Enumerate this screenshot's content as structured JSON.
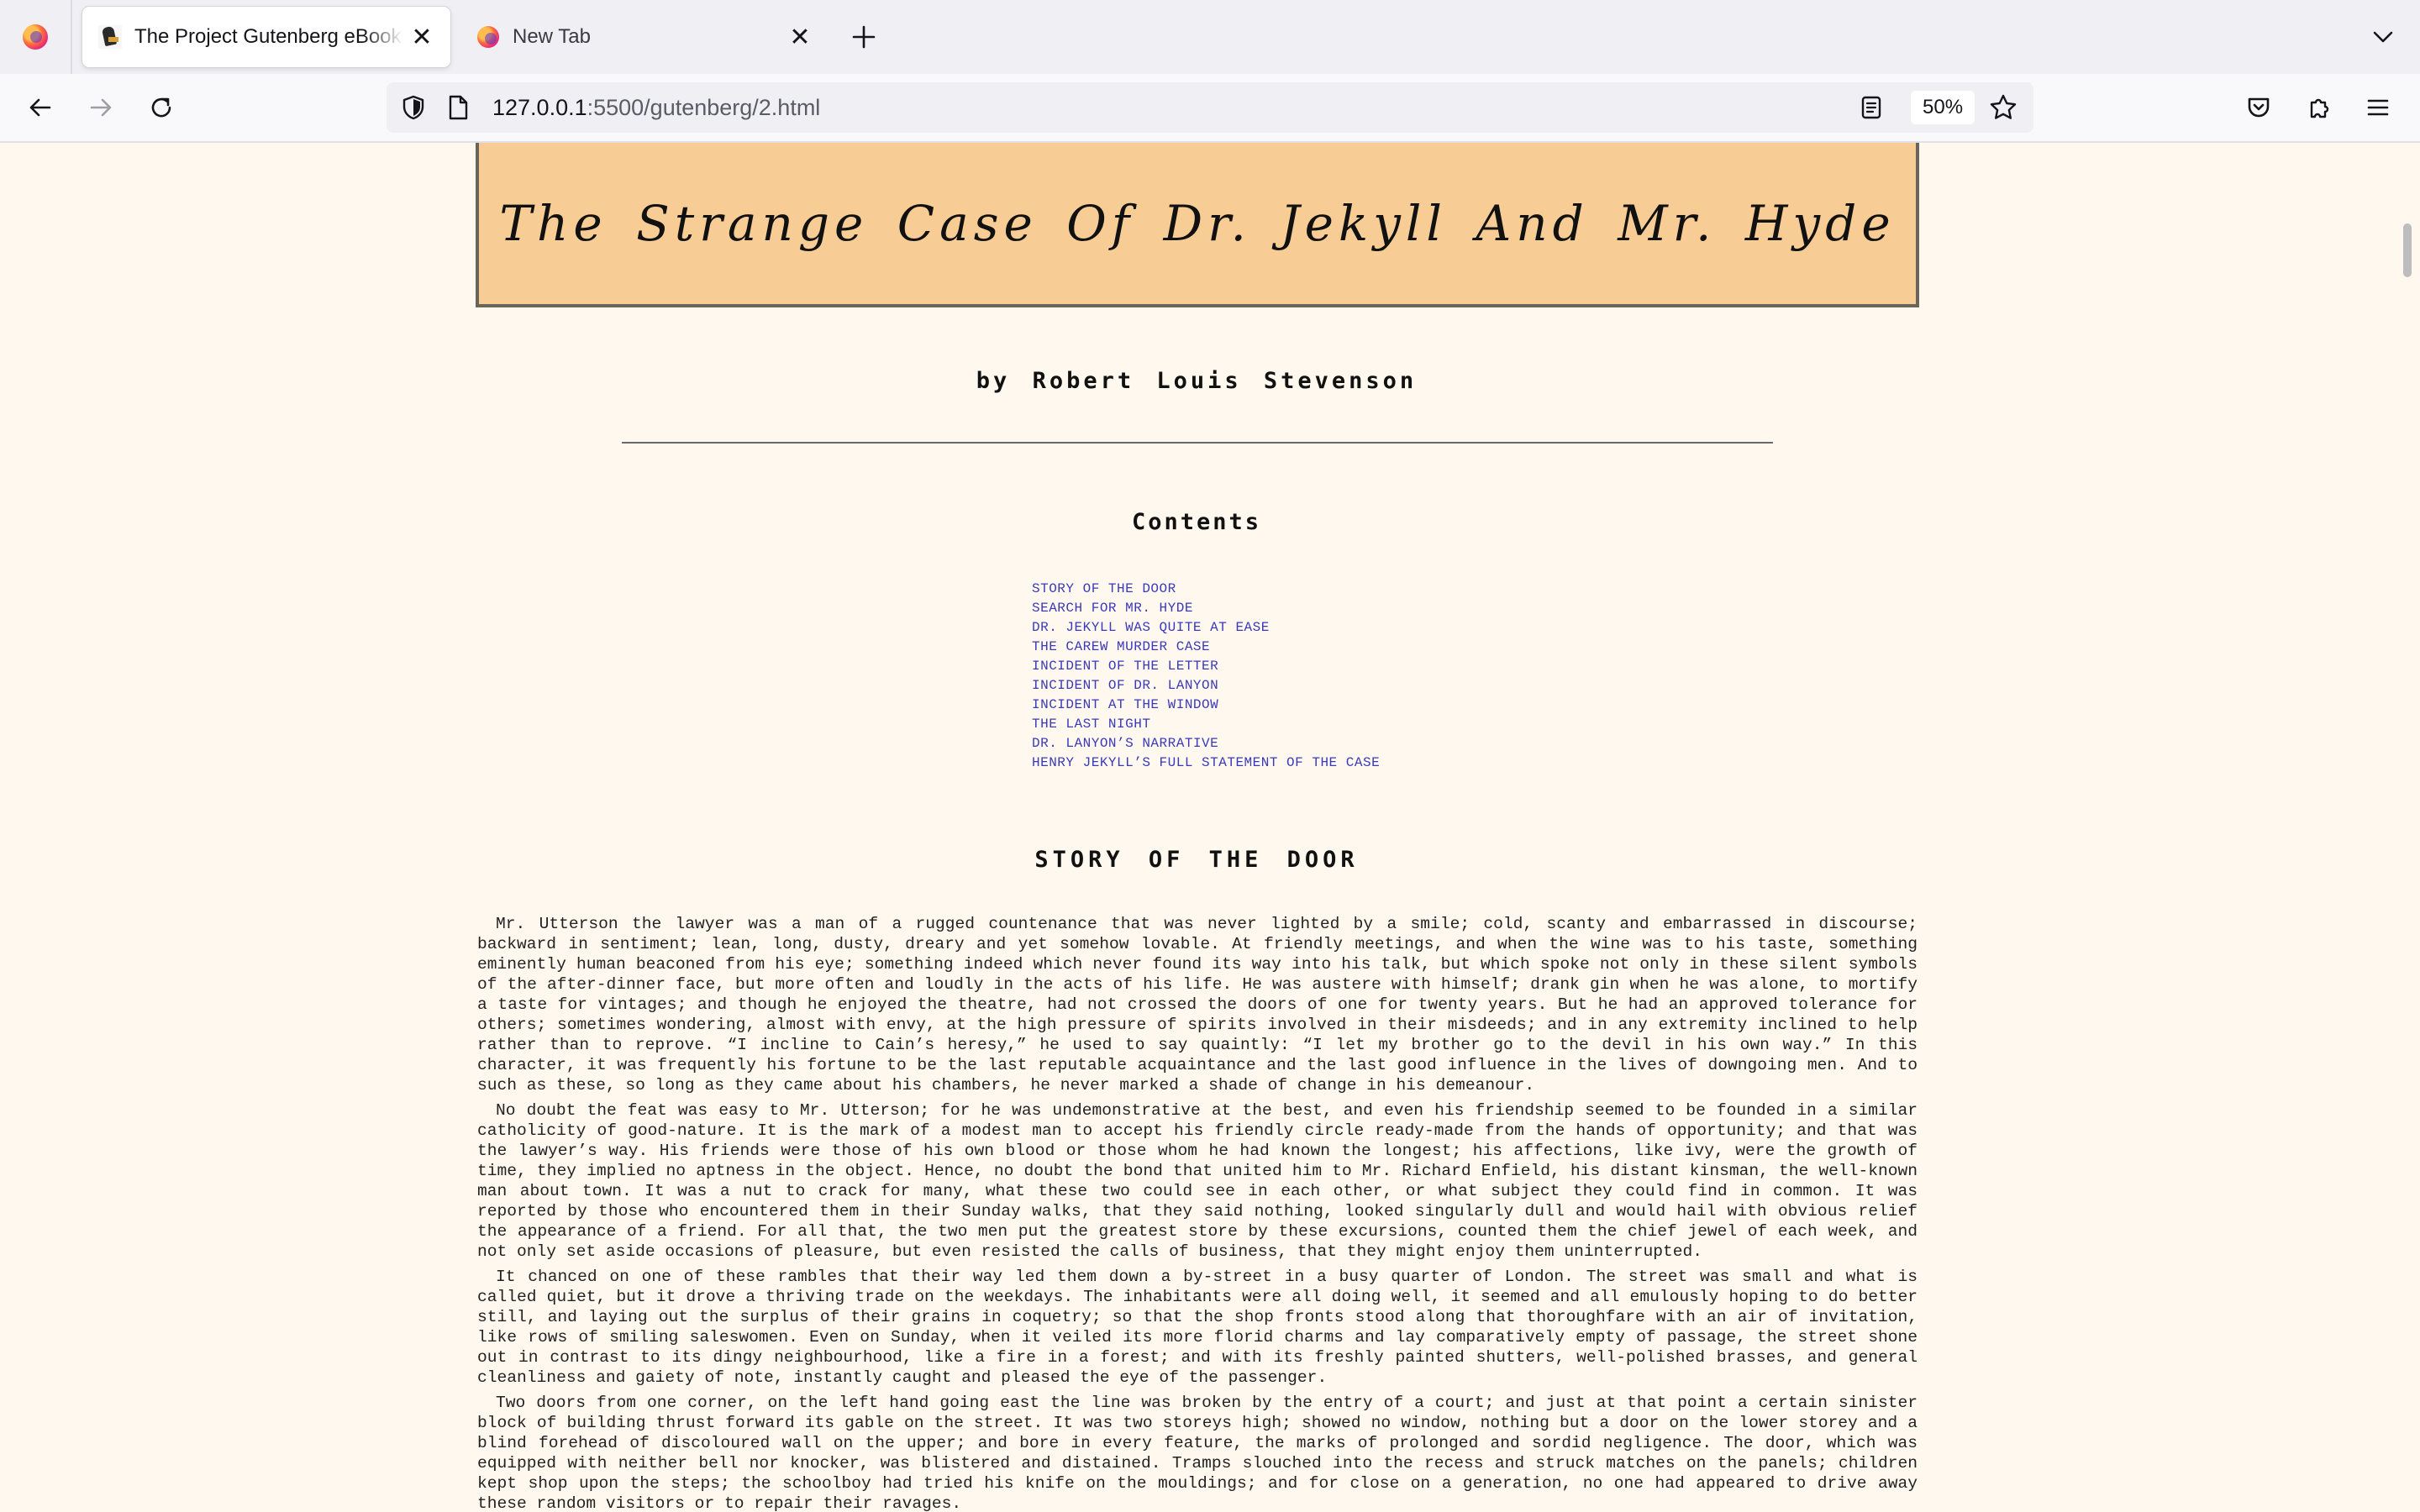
{
  "browser": {
    "tabs": [
      {
        "title": "The Project Gutenberg eBook of The Strange Case Of Dr. Jekyll And Mr. Hyde",
        "active": true
      },
      {
        "title": "New Tab",
        "active": false
      }
    ],
    "url_host": "127.0.0.1",
    "url_path": ":5500/gutenberg/2.html",
    "zoom": "50%"
  },
  "book": {
    "title": "The Strange Case Of Dr. Jekyll And Mr. Hyde",
    "author": "by Robert Louis Stevenson",
    "contents_heading": "Contents",
    "toc": [
      "STORY OF THE DOOR",
      "SEARCH FOR MR. HYDE",
      "DR. JEKYLL WAS QUITE AT EASE",
      "THE CAREW MURDER CASE",
      "INCIDENT OF THE LETTER",
      "INCIDENT OF DR. LANYON",
      "INCIDENT AT THE WINDOW",
      "THE LAST NIGHT",
      "DR. LANYON’S NARRATIVE",
      "HENRY JEKYLL’S FULL STATEMENT OF THE CASE"
    ],
    "chapter_heading": "STORY OF THE DOOR",
    "paragraphs": [
      "Mr. Utterson the lawyer was a man of a rugged countenance that was never lighted by a smile; cold, scanty and embarrassed in discourse; backward in sentiment; lean, long, dusty, dreary and yet somehow lovable. At friendly meetings, and when the wine was to his taste, something eminently human beaconed from his eye; something indeed which never found its way into his talk, but which spoke not only in these silent symbols of the after-dinner face, but more often and loudly in the acts of his life. He was austere with himself; drank gin when he was alone, to mortify a taste for vintages; and though he enjoyed the theatre, had not crossed the doors of one for twenty years. But he had an approved tolerance for others; sometimes wondering, almost with envy, at the high pressure of spirits involved in their misdeeds; and in any extremity inclined to help rather than to reprove. “I incline to Cain’s heresy,” he used to say quaintly: “I let my brother go to the devil in his own way.” In this character, it was frequently his fortune to be the last reputable acquaintance and the last good influence in the lives of downgoing men. And to such as these, so long as they came about his chambers, he never marked a shade of change in his demeanour.",
      "No doubt the feat was easy to Mr. Utterson; for he was undemonstrative at the best, and even his friendship seemed to be founded in a similar catholicity of good-nature. It is the mark of a modest man to accept his friendly circle ready-made from the hands of opportunity; and that was the lawyer’s way. His friends were those of his own blood or those whom he had known the longest; his affections, like ivy, were the growth of time, they implied no aptness in the object. Hence, no doubt the bond that united him to Mr. Richard Enfield, his distant kinsman, the well-known man about town. It was a nut to crack for many, what these two could see in each other, or what subject they could find in common. It was reported by those who encountered them in their Sunday walks, that they said nothing, looked singularly dull and would hail with obvious relief the appearance of a friend. For all that, the two men put the greatest store by these excursions, counted them the chief jewel of each week, and not only set aside occasions of pleasure, but even resisted the calls of business, that they might enjoy them uninterrupted.",
      "It chanced on one of these rambles that their way led them down a by-street in a busy quarter of London. The street was small and what is called quiet, but it drove a thriving trade on the weekdays. The inhabitants were all doing well, it seemed and all emulously hoping to do better still, and laying out the surplus of their grains in coquetry; so that the shop fronts stood along that thoroughfare with an air of invitation, like rows of smiling saleswomen. Even on Sunday, when it veiled its more florid charms and lay comparatively empty of passage, the street shone out in contrast to its dingy neighbourhood, like a fire in a forest; and with its freshly painted shutters, well-polished brasses, and general cleanliness and gaiety of note, instantly caught and pleased the eye of the passenger.",
      "Two doors from one corner, on the left hand going east the line was broken by the entry of a court; and just at that point a certain sinister block of building thrust forward its gable on the street. It was two storeys high; showed no window, nothing but a door on the lower storey and a blind forehead of discoloured wall on the upper; and bore in every feature, the marks of prolonged and sordid negligence. The door, which was equipped with neither bell nor knocker, was blistered and distained. Tramps slouched into the recess and struck matches on the panels; children kept shop upon the steps; the schoolboy had tried his knife on the mouldings; and for close on a generation, no one had appeared to drive away these random visitors or to repair their ravages."
    ]
  }
}
